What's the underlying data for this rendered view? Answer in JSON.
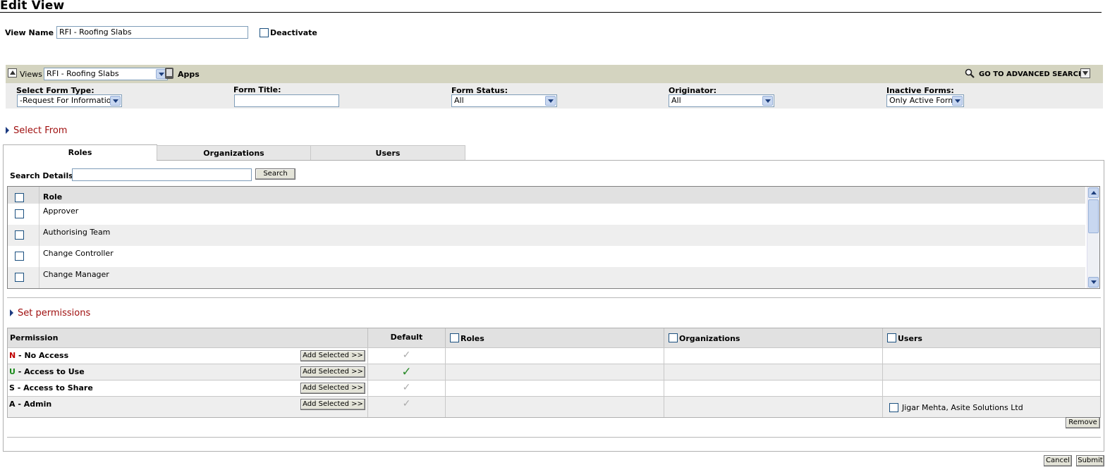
{
  "page": {
    "title": "Edit View"
  },
  "view_name": {
    "label": "View Name :",
    "value": "RFI - Roofing Slabs",
    "deactivate_label": "Deactivate"
  },
  "viewbar": {
    "views_label": "Views",
    "views_selected": "RFI - Roofing Slabs",
    "apps_label": "Apps",
    "advanced_search_label": "GO TO ADVANCED SEARCH"
  },
  "filters": {
    "form_type": {
      "label": "Select Form Type:",
      "value": "-Request For Information"
    },
    "form_title": {
      "label": "Form Title:",
      "value": ""
    },
    "form_status": {
      "label": "Form Status:",
      "value": "All"
    },
    "originator": {
      "label": "Originator:",
      "value": "All"
    },
    "inactive_forms": {
      "label": "Inactive Forms:",
      "value": "Only Active Forms"
    }
  },
  "select_from": {
    "heading": "Select From",
    "tabs": [
      "Roles",
      "Organizations",
      "Users"
    ],
    "search_label": "Search Details:",
    "search_value": "",
    "search_button": "Search",
    "list_header": "Role",
    "roles": [
      "Approver",
      "Authorising Team",
      "Change Controller",
      "Change Manager"
    ]
  },
  "permissions": {
    "heading": "Set permissions",
    "headers": {
      "permission": "Permission",
      "default": "Default",
      "roles": "Roles",
      "organizations": "Organizations",
      "users": "Users"
    },
    "add_button": "Add Selected >>",
    "rows": [
      {
        "code": "N",
        "code_color": "#c00000",
        "label": " - No Access",
        "default": false
      },
      {
        "code": "U",
        "code_color": "#1a8a1a",
        "label": " - Access to Use",
        "default": true
      },
      {
        "code": "S",
        "code_color": "#000000",
        "label": " - Access to Share",
        "default": false
      },
      {
        "code": "A",
        "code_color": "#000000",
        "label": " - Admin",
        "default": false
      }
    ],
    "tick_glyph": "✓",
    "assigned_user": "Jigar Mehta, Asite Solutions Ltd",
    "remove_button": "Remove"
  },
  "footer": {
    "cancel": "Cancel",
    "submit": "Submit"
  },
  "colors": {
    "section_heading": "#a01010",
    "viewbar_bg": "#d4d4c0",
    "filter_bg": "#ececec"
  },
  "icons": {
    "collapse": "collapse-icon",
    "apps": "apps-icon",
    "search": "magnifier-icon",
    "expand": "expand-icon"
  }
}
